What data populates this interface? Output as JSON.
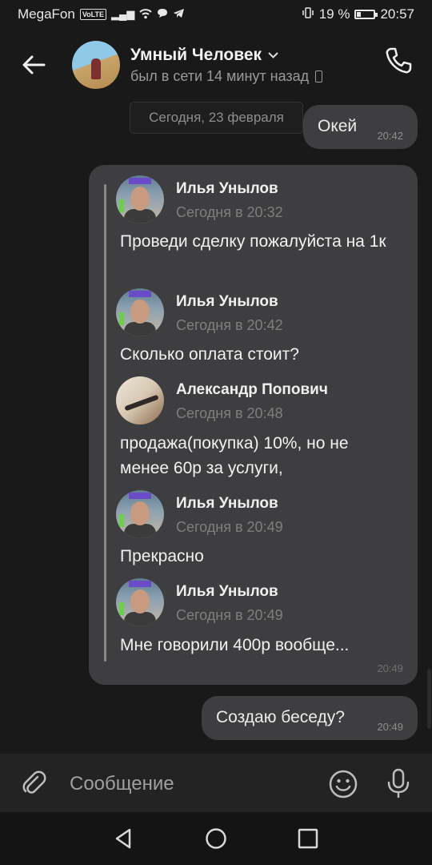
{
  "status_bar": {
    "carrier": "MegaFon",
    "volte": "VoLTE",
    "battery_percent": "19 %",
    "battery_level": 0.19,
    "time": "20:57"
  },
  "header": {
    "title": "Умный Человек",
    "subtitle": "был в сети 14 минут назад"
  },
  "chat": {
    "date_label": "Сегодня, 23 февраля",
    "messages": [
      {
        "text": "Окей",
        "time": "20:42"
      }
    ],
    "forwarded": {
      "time": "20:49",
      "items": [
        {
          "name": "Илья Унылов",
          "time": "Сегодня в 20:32",
          "text": "Проведи сделку пожалуйста на 1к"
        },
        {
          "name": "Илья Унылов",
          "time": "Сегодня в 20:42",
          "text": "Сколько оплата стоит?"
        },
        {
          "name": "Александр Попович",
          "time": "Сегодня в 20:48",
          "text": "продажа(покупка) 10%, но не менее 60р за услуги,"
        },
        {
          "name": "Илья Унылов",
          "time": "Сегодня в 20:49",
          "text": "Прекрасно"
        },
        {
          "name": "Илья Унылов",
          "time": "Сегодня в 20:49",
          "text": "Мне говорили 400р вообще..."
        }
      ]
    },
    "last_message": {
      "text": "Создаю беседу?",
      "time": "20:49"
    }
  },
  "input": {
    "placeholder": "Сообщение"
  },
  "colors": {
    "background": "#191919",
    "bubble": "#3e3e40",
    "input_bar": "#232323"
  }
}
